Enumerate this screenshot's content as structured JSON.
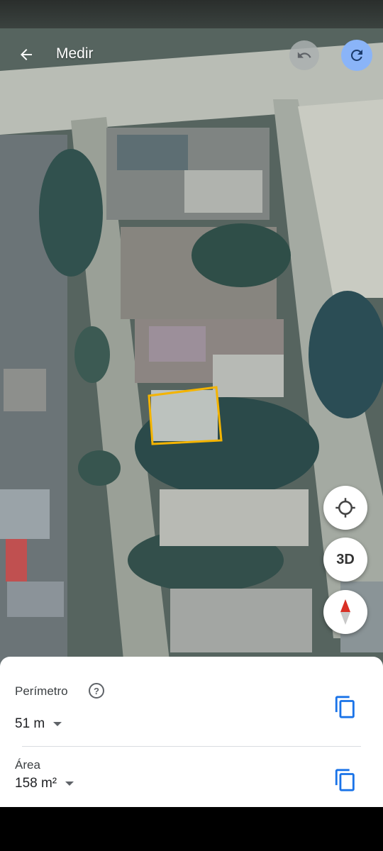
{
  "header": {
    "title": "Medir",
    "back_icon": "arrow-left-icon",
    "undo_icon": "undo-icon",
    "redo_icon": "redo-icon"
  },
  "map": {
    "type": "satellite",
    "measured_polygon_color": "#f4b400"
  },
  "controls": {
    "location_icon": "my-location-icon",
    "view_3d_label": "3D",
    "compass_icon": "compass-icon"
  },
  "sheet": {
    "perimeter_label": "Perímetro",
    "perimeter_value": "51 m",
    "area_label": "Área",
    "area_value": "158 m²",
    "help_icon": "help-icon",
    "copy_icon": "copy-icon"
  },
  "colors": {
    "accent": "#1a73e8",
    "redo_bg": "#8ab4f8"
  }
}
